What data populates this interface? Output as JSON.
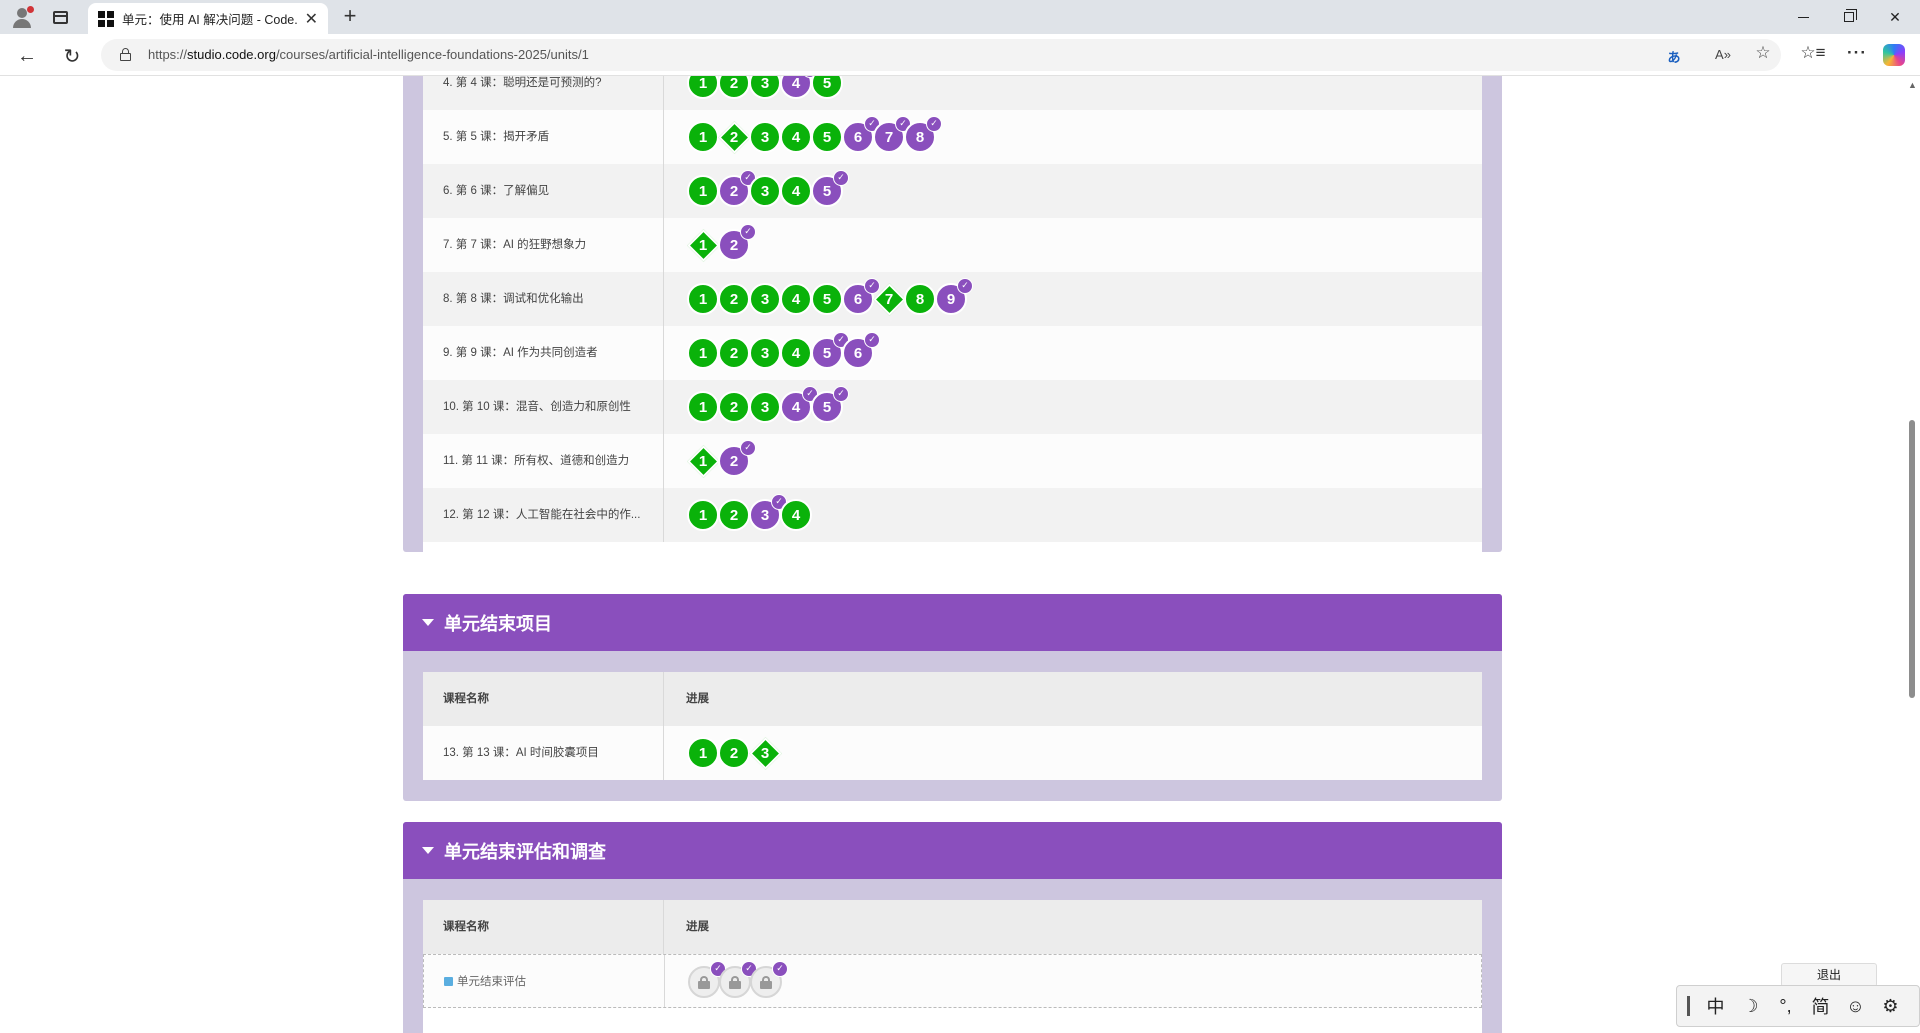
{
  "browser": {
    "tab_title": "单元：使用 AI 解决问题 - Code.org",
    "url_scheme": "https://",
    "url_host": "studio.code.org",
    "url_path": "/courses/artificial-intelligence-foundations-2025/units/1"
  },
  "colors": {
    "complete_green": "#0ab20a",
    "assessment_purple": "#8a4fbd",
    "section_header": "#8a4fbd",
    "section_bg": "#cdc6df"
  },
  "lessons_section": {
    "rows": [
      {
        "name": "4. 第 4 课：聪明还是可预测的?",
        "bubbles": [
          {
            "n": "1",
            "kind": "circle",
            "color": "green",
            "check": false
          },
          {
            "n": "2",
            "kind": "circle",
            "color": "green",
            "check": false
          },
          {
            "n": "3",
            "kind": "circle",
            "color": "green",
            "check": false
          },
          {
            "n": "4",
            "kind": "circle",
            "color": "purple",
            "check": true
          },
          {
            "n": "5",
            "kind": "circle",
            "color": "green",
            "check": false
          }
        ]
      },
      {
        "name": "5. 第 5 课：揭开矛盾",
        "bubbles": [
          {
            "n": "1",
            "kind": "circle",
            "color": "green",
            "check": false
          },
          {
            "n": "2",
            "kind": "diamond",
            "color": "green",
            "check": false
          },
          {
            "n": "3",
            "kind": "circle",
            "color": "green",
            "check": false
          },
          {
            "n": "4",
            "kind": "circle",
            "color": "green",
            "check": false
          },
          {
            "n": "5",
            "kind": "circle",
            "color": "green",
            "check": false
          },
          {
            "n": "6",
            "kind": "circle",
            "color": "purple",
            "check": true
          },
          {
            "n": "7",
            "kind": "circle",
            "color": "purple",
            "check": true
          },
          {
            "n": "8",
            "kind": "circle",
            "color": "purple",
            "check": true
          }
        ]
      },
      {
        "name": "6. 第 6 课：了解偏见",
        "bubbles": [
          {
            "n": "1",
            "kind": "circle",
            "color": "green",
            "check": false
          },
          {
            "n": "2",
            "kind": "circle",
            "color": "purple",
            "check": true
          },
          {
            "n": "3",
            "kind": "circle",
            "color": "green",
            "check": false
          },
          {
            "n": "4",
            "kind": "circle",
            "color": "green",
            "check": false
          },
          {
            "n": "5",
            "kind": "circle",
            "color": "purple",
            "check": true
          }
        ]
      },
      {
        "name": "7. 第 7 课：AI 的狂野想象力",
        "bubbles": [
          {
            "n": "1",
            "kind": "diamond",
            "color": "green",
            "check": false
          },
          {
            "n": "2",
            "kind": "circle",
            "color": "purple",
            "check": true
          }
        ]
      },
      {
        "name": "8. 第 8 课：调试和优化输出",
        "bubbles": [
          {
            "n": "1",
            "kind": "circle",
            "color": "green",
            "check": false
          },
          {
            "n": "2",
            "kind": "circle",
            "color": "green",
            "check": false
          },
          {
            "n": "3",
            "kind": "circle",
            "color": "green",
            "check": false
          },
          {
            "n": "4",
            "kind": "circle",
            "color": "green",
            "check": false
          },
          {
            "n": "5",
            "kind": "circle",
            "color": "green",
            "check": false
          },
          {
            "n": "6",
            "kind": "circle",
            "color": "purple",
            "check": true
          },
          {
            "n": "7",
            "kind": "diamond",
            "color": "green",
            "check": false
          },
          {
            "n": "8",
            "kind": "circle",
            "color": "green",
            "check": false
          },
          {
            "n": "9",
            "kind": "circle",
            "color": "purple",
            "check": true
          }
        ]
      },
      {
        "name": "9. 第 9 课：AI 作为共同创造者",
        "bubbles": [
          {
            "n": "1",
            "kind": "circle",
            "color": "green",
            "check": false
          },
          {
            "n": "2",
            "kind": "circle",
            "color": "green",
            "check": false
          },
          {
            "n": "3",
            "kind": "circle",
            "color": "green",
            "check": false
          },
          {
            "n": "4",
            "kind": "circle",
            "color": "green",
            "check": false
          },
          {
            "n": "5",
            "kind": "circle",
            "color": "purple",
            "check": true
          },
          {
            "n": "6",
            "kind": "circle",
            "color": "purple",
            "check": true
          }
        ]
      },
      {
        "name": "10. 第 10 课：混音、创造力和原创性",
        "bubbles": [
          {
            "n": "1",
            "kind": "circle",
            "color": "green",
            "check": false
          },
          {
            "n": "2",
            "kind": "circle",
            "color": "green",
            "check": false
          },
          {
            "n": "3",
            "kind": "circle",
            "color": "green",
            "check": false
          },
          {
            "n": "4",
            "kind": "circle",
            "color": "purple",
            "check": true
          },
          {
            "n": "5",
            "kind": "circle",
            "color": "purple",
            "check": true
          }
        ]
      },
      {
        "name": "11. 第 11 课：所有权、道德和创造力",
        "bubbles": [
          {
            "n": "1",
            "kind": "diamond",
            "color": "green",
            "check": false
          },
          {
            "n": "2",
            "kind": "circle",
            "color": "purple",
            "check": true
          }
        ]
      },
      {
        "name": "12. 第 12 课：人工智能在社会中的作...",
        "bubbles": [
          {
            "n": "1",
            "kind": "circle",
            "color": "green",
            "check": false
          },
          {
            "n": "2",
            "kind": "circle",
            "color": "green",
            "check": false
          },
          {
            "n": "3",
            "kind": "circle",
            "color": "purple",
            "check": true
          },
          {
            "n": "4",
            "kind": "circle",
            "color": "green",
            "check": false
          }
        ]
      }
    ]
  },
  "project_section": {
    "title": "单元结束项目",
    "col_lesson": "课程名称",
    "col_progress": "进展",
    "rows": [
      {
        "name": "13. 第 13 课：AI 时间胶囊项目",
        "bubbles": [
          {
            "n": "1",
            "kind": "circle",
            "color": "green",
            "check": false
          },
          {
            "n": "2",
            "kind": "circle",
            "color": "green",
            "check": false
          },
          {
            "n": "3",
            "kind": "diamond",
            "color": "green",
            "check": false
          }
        ]
      }
    ]
  },
  "assessment_section": {
    "title": "单元结束评估和调查",
    "col_lesson": "课程名称",
    "col_progress": "进展",
    "rows": [
      {
        "name": "单元结束评估",
        "locked": true,
        "bubbles": [
          {
            "n": "",
            "kind": "locked",
            "color": "grey",
            "check": true
          },
          {
            "n": "",
            "kind": "locked",
            "color": "grey",
            "check": true
          },
          {
            "n": "",
            "kind": "locked",
            "color": "grey",
            "check": true
          }
        ]
      }
    ]
  },
  "widgets": {
    "exit_label": "退出",
    "ime": [
      "中",
      "☽",
      "°,",
      "简",
      "☺",
      "⚙"
    ]
  }
}
